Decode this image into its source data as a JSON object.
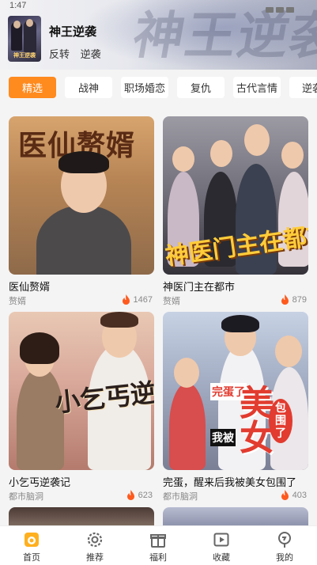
{
  "status": {
    "time": "1:47"
  },
  "featured": {
    "title": "神王逆袭",
    "tags": [
      "反转",
      "逆袭"
    ],
    "thumb_caption": "神王逆袭",
    "banner_watermark": "神王逆袭"
  },
  "categories": [
    {
      "label": "精选",
      "active": true
    },
    {
      "label": "战神",
      "active": false
    },
    {
      "label": "职场婚恋",
      "active": false
    },
    {
      "label": "复仇",
      "active": false
    },
    {
      "label": "古代言情",
      "active": false
    },
    {
      "label": "逆袭",
      "active": false
    }
  ],
  "cards": [
    {
      "title": "医仙赘婿",
      "genre": "赘婿",
      "hot": "1467",
      "poster_text": "医仙赘婿"
    },
    {
      "title": "神医门主在都市",
      "genre": "赘婿",
      "hot": "879",
      "poster_text": "神医门主在都市"
    },
    {
      "title": "小乞丐逆袭记",
      "genre": "都市脑洞",
      "hot": "623",
      "poster_text": "小乞丐逆袭记"
    },
    {
      "title": "完蛋，醒来后我被美女包围了",
      "genre": "都市脑洞",
      "hot": "403",
      "poster_text_a": "完蛋了",
      "poster_text_b": "我被",
      "poster_text_c": "美女",
      "poster_text_d": "包围了"
    }
  ],
  "bottom_nav": [
    {
      "label": "首页",
      "icon": "home-icon",
      "active": true
    },
    {
      "label": "推荐",
      "icon": "gear-icon",
      "active": false
    },
    {
      "label": "福利",
      "icon": "gift-icon",
      "active": false
    },
    {
      "label": "收藏",
      "icon": "play-box-icon",
      "active": false
    },
    {
      "label": "我的",
      "icon": "profile-icon",
      "active": false
    }
  ],
  "colors": {
    "accent": "#ff8a1e",
    "hot_flame": "#ff5a1e"
  }
}
